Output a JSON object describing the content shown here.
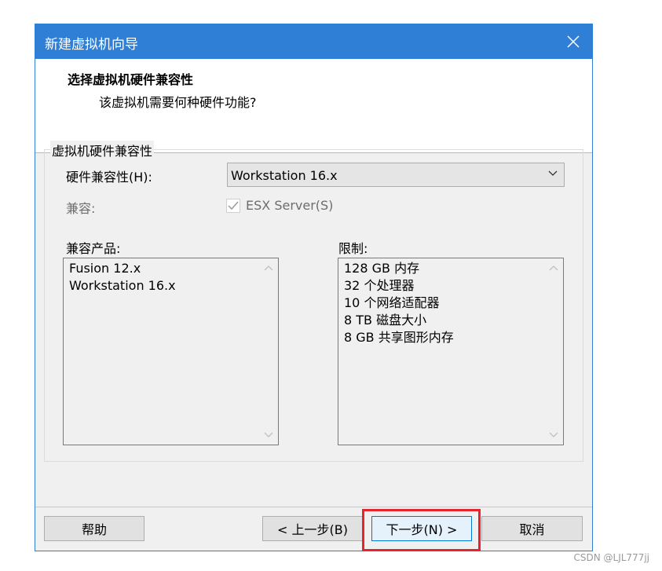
{
  "window": {
    "title": "新建虚拟机向导"
  },
  "header": {
    "heading": "选择虚拟机硬件兼容性",
    "subheading": "该虚拟机需要何种硬件功能?"
  },
  "group": {
    "title": "虚拟机硬件兼容性",
    "hw_label": "硬件兼容性(H):",
    "hw_value": "Workstation 16.x",
    "compat_label": "兼容:",
    "esx_checked": true,
    "esx_label": "ESX Server(S)",
    "products_label": "兼容产品:",
    "products": [
      "Fusion 12.x",
      "Workstation 16.x"
    ],
    "limits_label": "限制:",
    "limits": [
      "128 GB 内存",
      "32 个处理器",
      "10 个网络适配器",
      "8 TB 磁盘大小",
      "8 GB 共享图形内存"
    ]
  },
  "buttons": {
    "help": "帮助",
    "back": "< 上一步(B)",
    "next": "下一步(N) >",
    "cancel": "取消"
  },
  "watermark": "CSDN @LJL777jj",
  "colors": {
    "titlebar": "#2f7fd6",
    "highlight": "#e8232b",
    "primary_border": "#0078d7"
  },
  "icons": {
    "close": "close-icon",
    "dropdown": "chevron-down-icon",
    "check": "checkmark-icon"
  }
}
